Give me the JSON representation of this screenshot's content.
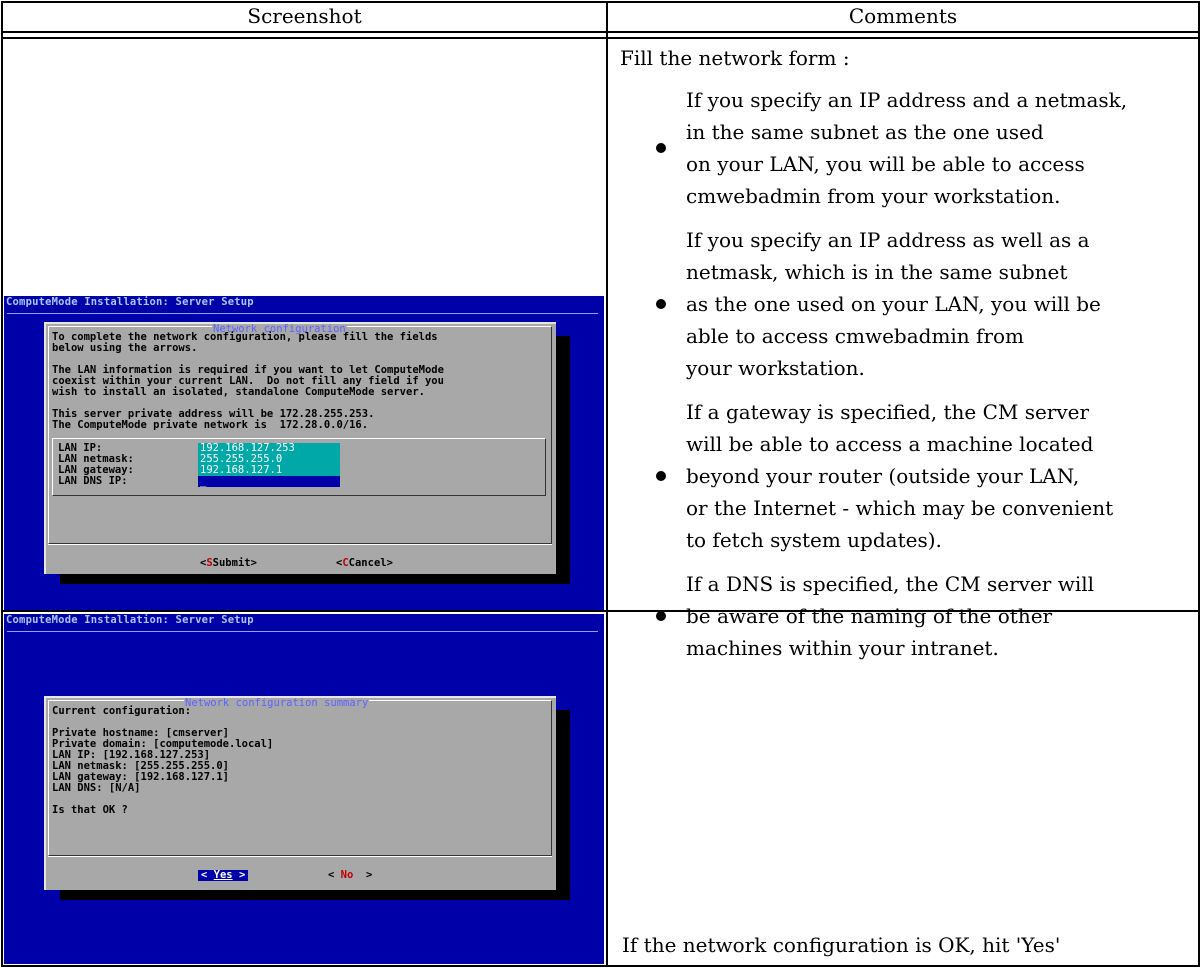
{
  "table": {
    "header_screenshot": "Screenshot",
    "header_comments": "Comments"
  },
  "comments": {
    "lead": "Fill the network form :",
    "bullets": [
      [
        "If you specify an IP address and a netmask,",
        "in the same subnet as the one used",
        "on your LAN, you will be able to access",
        "cmwebadmin from your workstation."
      ],
      [
        "If you specify an IP address as well as a",
        "netmask, which is in the same subnet",
        "as the one used on your LAN, you will be",
        "able to access cmwebadmin from",
        "your workstation."
      ],
      [
        "If a gateway is specified, the CM server",
        "will be able to access a machine located",
        "beyond your router (outside your LAN,",
        "or the Internet - which may be convenient",
        "to fetch system updates)."
      ],
      [
        "If a DNS is specified, the CM server will",
        "be aware of the naming of the other",
        "machines within your intranet."
      ]
    ],
    "ok_note": "If the network configuration is OK, hit 'Yes'"
  },
  "screen1": {
    "title": "ComputeMode Installation: Server Setup",
    "dialog_title": "Network configuration",
    "body": [
      "To complete the network configuration, please fill the fields",
      "below using the arrows.",
      "",
      "The LAN information is required if you want to let ComputeMode",
      "coexist within your current LAN.  Do not fill any field if you",
      "wish to install an isolated, standalone ComputeMode server.",
      "",
      "This server private address will be 172.28.255.253.",
      "The ComputeMode private network is  172.28.0.0/16."
    ],
    "fields": [
      {
        "label": "LAN IP:",
        "value": "192.168.127.253"
      },
      {
        "label": "LAN netmask:",
        "value": "255.255.255.0"
      },
      {
        "label": "LAN gateway:",
        "value": "192.168.127.1"
      },
      {
        "label": "LAN DNS IP:",
        "value": "_"
      }
    ],
    "submit_label": "Submit",
    "cancel_label": "Cancel"
  },
  "screen2": {
    "title": "ComputeMode Installation: Server Setup",
    "dialog_title": "Network configuration summary",
    "body": [
      "Current configuration:",
      "",
      "Private hostname: [cmserver]",
      "Private domain: [computemode.local]",
      "LAN IP: [192.168.127.253]",
      "LAN netmask: [255.255.255.0]",
      "LAN gateway: [192.168.127.1]",
      "LAN DNS: [N/A]",
      "",
      "Is that OK ?"
    ],
    "yes_label": "Yes",
    "no_label": "No"
  },
  "colors": {
    "screen_bg": "#0000a8",
    "dialog_bg": "#a8a8a8",
    "field_bg": "#00a8a8",
    "hotkey": "#c00000"
  }
}
